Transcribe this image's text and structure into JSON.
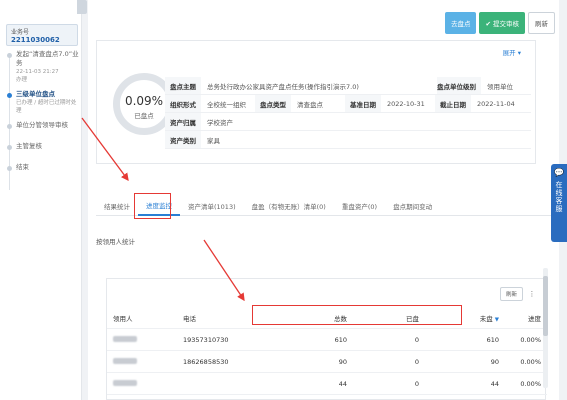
{
  "sidebar": {
    "order_label": "业务号",
    "order_no": "2211030062",
    "timeline": [
      {
        "title": "发起“清查盘点7.0”业务",
        "sub": "22-11-03 21:27",
        "sub2": "办理",
        "active": false
      },
      {
        "title": "三级单位盘点",
        "sub": "已办理 / 超时已过期时处理",
        "sub2": "",
        "active": true
      },
      {
        "title": "单位分管领导审核",
        "sub": "",
        "sub2": "",
        "active": false
      },
      {
        "title": "主管复核",
        "sub": "",
        "sub2": "",
        "active": false
      },
      {
        "title": "结束",
        "sub": "",
        "sub2": "",
        "active": false
      }
    ]
  },
  "actions": {
    "back_label": "去盘点",
    "submit_label": "✔ 提交审核",
    "refresh_label": "刷新"
  },
  "info": {
    "expand_label": "展开 ▾",
    "progress_pct": "0.09%",
    "progress_label": "已盘点",
    "progress_value": 0.09,
    "subject_label": "盘点主题",
    "subject_value": "总务处行政办公家具资产盘点任务(操作指引演示7.0)",
    "unit_level_label": "盘点单位级别",
    "unit_level_value": "领用单位",
    "form_label": "组织形式",
    "form_value": "全校统一组织",
    "type_label": "盘点类型",
    "type_value": "清查盘点",
    "base_date_label": "基准日期",
    "base_date_value": "2022-10-31",
    "deadline_label": "截止日期",
    "deadline_value": "2022-11-04",
    "belong_label": "资产归属",
    "belong_value": "学校资产",
    "category_label": "资产类别",
    "category_value": "家具"
  },
  "tabs": [
    {
      "label": "结果统计",
      "active": false
    },
    {
      "label": "进度监控",
      "active": true
    },
    {
      "label": "资产清单(1013)",
      "active": false
    },
    {
      "label": "盘盈（有物无账）清单(0)",
      "active": false
    },
    {
      "label": "重盘资产(0)",
      "active": false
    },
    {
      "label": "盘点期间变动",
      "active": false
    }
  ],
  "section_label": "按领用人统计",
  "table": {
    "refresh_label": "刷新",
    "headers": [
      "领用人",
      "电话",
      "总数",
      "已盘",
      "未盘",
      "进度"
    ],
    "rows": [
      {
        "phone": "19357310730",
        "total": "610",
        "done": "0",
        "pending": "610",
        "progress": "0.00%"
      },
      {
        "phone": "18626858530",
        "total": "90",
        "done": "0",
        "pending": "90",
        "progress": "0.00%"
      },
      {
        "phone": "",
        "total": "44",
        "done": "0",
        "pending": "44",
        "progress": "0.00%"
      }
    ]
  },
  "service": {
    "label": "在线客服"
  },
  "colors": {
    "accent": "#2a7fd4",
    "submit": "#3bb37a",
    "highlight": "#e53935"
  }
}
